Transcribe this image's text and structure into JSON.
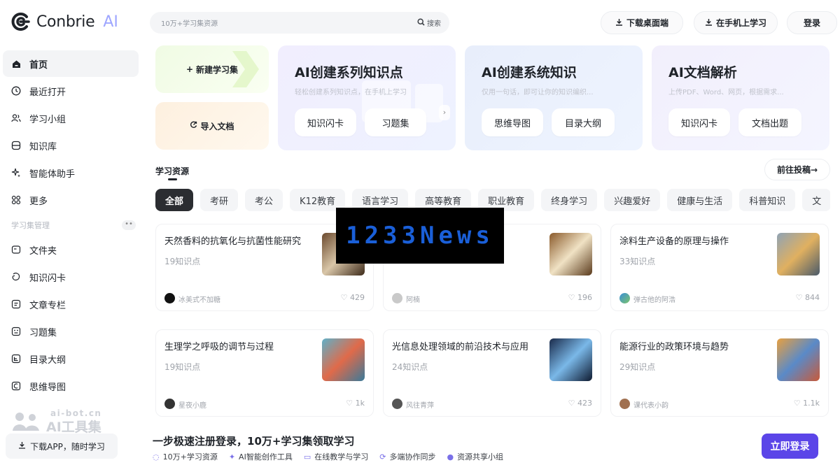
{
  "logo": {
    "name": "Conbrie",
    "ai": "AI"
  },
  "nav": {
    "items": [
      {
        "label": "首页",
        "icon": "home-icon"
      },
      {
        "label": "最近打开",
        "icon": "clock-icon"
      },
      {
        "label": "学习小组",
        "icon": "group-icon"
      },
      {
        "label": "知识库",
        "icon": "database-icon"
      },
      {
        "label": "智能体助手",
        "icon": "sparkle-icon"
      },
      {
        "label": "更多",
        "icon": "grid-icon"
      }
    ],
    "section_title": "学习集管理",
    "section_items": [
      {
        "label": "文件夹",
        "icon": "folder-icon"
      },
      {
        "label": "知识闪卡",
        "icon": "flashcard-icon"
      },
      {
        "label": "文章专栏",
        "icon": "article-icon"
      },
      {
        "label": "习题集",
        "icon": "quiz-icon"
      },
      {
        "label": "目录大纲",
        "icon": "outline-icon"
      },
      {
        "label": "思维导图",
        "icon": "mindmap-icon"
      }
    ]
  },
  "watermark": {
    "small": "ai-bot.cn",
    "big": "AI工具集"
  },
  "download_app": "下载APP，随时学习",
  "search": {
    "placeholder": "10万+学习集资源",
    "button": "搜索"
  },
  "topbar": {
    "download_desktop": "下载桌面端",
    "mobile_learn": "在手机上学习",
    "login": "登录"
  },
  "quick_actions": {
    "new_set": "新建学习集",
    "import_doc": "导入文档"
  },
  "features": [
    {
      "title": "AI创建系列知识点",
      "subtitle": "轻松创建系列知识点，在手机上学习",
      "buttons": [
        "知识闪卡",
        "习题集"
      ]
    },
    {
      "title": "AI创建系统知识",
      "subtitle": "仅用一句话，即可让你的知识编织...",
      "buttons": [
        "思维导图",
        "目录大纲"
      ]
    },
    {
      "title": "AI文档解析",
      "subtitle": "上传PDF、Word、网页，根据需求...",
      "buttons": [
        "知识闪卡",
        "文档出题"
      ]
    }
  ],
  "resources": {
    "title": "学习资源",
    "post_button": "前往投稿→"
  },
  "categories": [
    "全部",
    "考研",
    "考公",
    "K12教育",
    "语言学习",
    "高等教育",
    "职业教育",
    "终身学习",
    "兴趣爱好",
    "健康与生活",
    "科普知识",
    "文"
  ],
  "cards": [
    {
      "title": "天然香料的抗氧化与抗菌性能研究",
      "count": "19知识点",
      "author": "冰美式不加糖",
      "likes": "429"
    },
    {
      "title": "",
      "count": "",
      "author": "阿楠",
      "likes": "196"
    },
    {
      "title": "涂料生产设备的原理与操作",
      "count": "33知识点",
      "author": "弹古他的阿浩",
      "likes": "844"
    },
    {
      "title": "生理学之呼吸的调节与过程",
      "count": "19知识点",
      "author": "星夜小鹿",
      "likes": "1k"
    },
    {
      "title": "光信息处理领域的前沿技术与应用",
      "count": "24知识点",
      "author": "风往青萍",
      "likes": "423"
    },
    {
      "title": "能源行业的政策环境与趋势",
      "count": "29知识点",
      "author": "课代表小韵",
      "likes": "1.1k"
    }
  ],
  "news_overlay": "1233News",
  "bottom_banner": {
    "title": "一步极速注册登录，10万+学习集领取学习",
    "features": [
      "10万+学习资源",
      "AI智能创作工具",
      "在线教学与学习",
      "多端协作同步",
      "资源共享小组"
    ],
    "cta": "立即登录"
  },
  "colors": {
    "accent": "#5b45e8",
    "dark": "#2b2d31",
    "muted": "#a0a4ab"
  }
}
